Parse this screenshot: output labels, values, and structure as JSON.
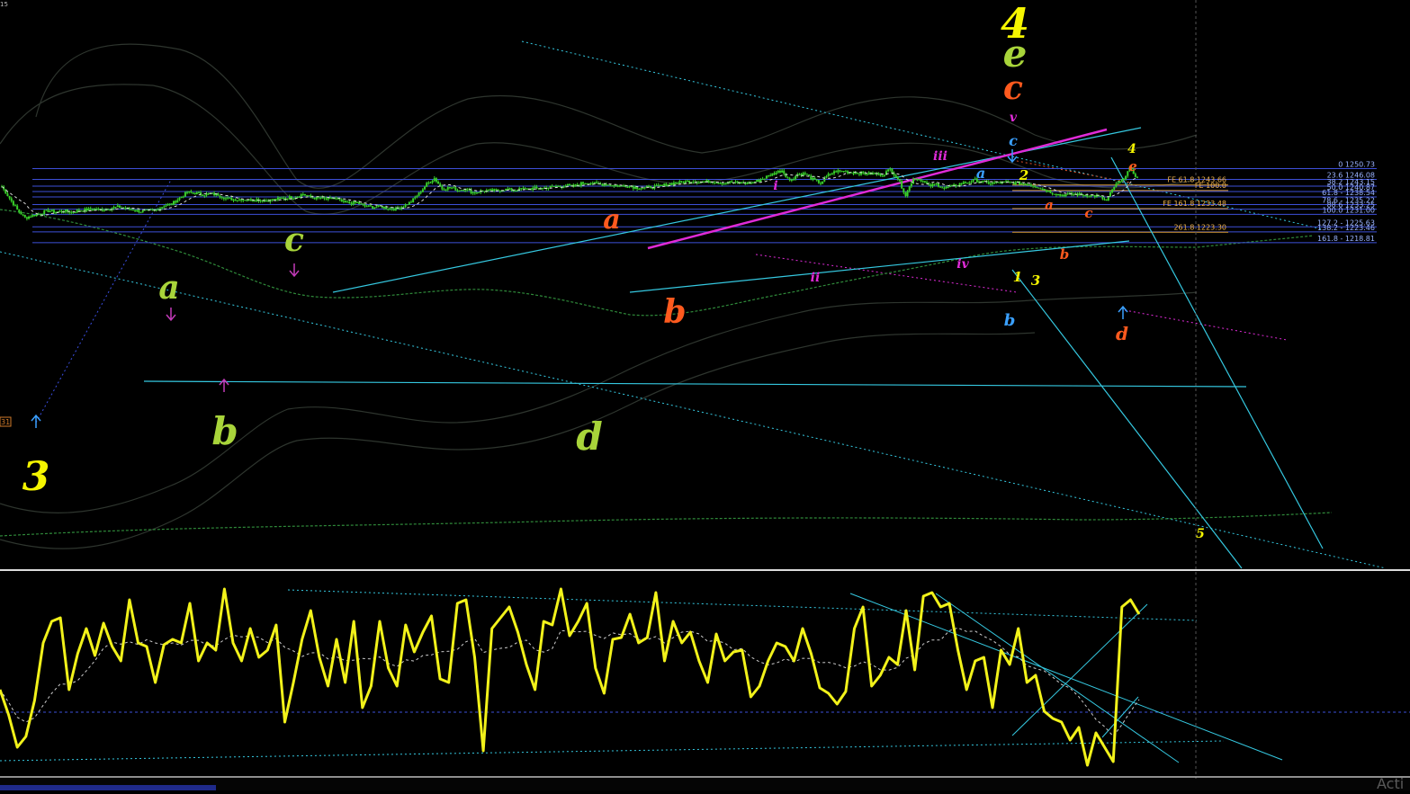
{
  "corner_tag": "15",
  "left_price_tag": "31",
  "watermark": "Acti",
  "colors": {
    "background": "#000000",
    "candle": "#39d12a",
    "fib_line": "#3d4fd8",
    "fib_text": "#9ab3ff",
    "fe_line": "#d89a36",
    "fe_text": "#f0b24a",
    "channel": "#35c8e0",
    "magenta": "#e02bd8",
    "oscillator": "#f2f21a"
  },
  "chart_data": [
    {
      "type": "line",
      "panel": "price",
      "y_scale": "price",
      "fib_retracement": [
        {
          "label": "0 1250.73",
          "level": 1250.73
        },
        {
          "label": "23.6 1246.08",
          "level": 1246.08
        },
        {
          "label": "38.2 1243.15",
          "level": 1243.15
        },
        {
          "label": "50.0 1240.87",
          "level": 1240.87
        },
        {
          "label": "61.8 - 1238.54",
          "level": 1238.54
        },
        {
          "label": "78.6 - 1235.22",
          "level": 1235.22
        },
        {
          "label": "88.6 1233.25",
          "level": 1233.25
        },
        {
          "label": "100.0 1231.00",
          "level": 1231.0
        },
        {
          "label": "127.2 - 1225.63",
          "level": 1225.63
        },
        {
          "label": "138.2 - 1223.46",
          "level": 1223.46
        },
        {
          "label": "161.8 - 1218.81",
          "level": 1218.81
        }
      ],
      "fib_expansion": [
        {
          "label": "FE 61.8 1243.66",
          "level": 1243.66
        },
        {
          "label": "FE 100.0",
          "level": 1241.3
        },
        {
          "label": "FE 161.8 1233.48",
          "level": 1233.48
        },
        {
          "label": "261.8 1223.30",
          "level": 1223.3
        }
      ],
      "series": [
        {
          "values": [
            1243.0,
            1238.0,
            1233.0,
            1229.5,
            1230.5,
            1231.5,
            1232.5,
            1232.0,
            1232.5,
            1232.0,
            1232.7,
            1233.0,
            1233.2,
            1233.0,
            1233.6,
            1234.2,
            1233.6,
            1233.0,
            1232.2,
            1232.6,
            1233.0,
            1234.8,
            1235.5,
            1238.0,
            1240.5,
            1240.2,
            1239.6,
            1239.8,
            1239.5,
            1237.9,
            1237.4,
            1237.6,
            1237.2,
            1237.4,
            1237.0,
            1237.2,
            1237.8,
            1238.2,
            1238.5,
            1239.8,
            1238.2,
            1238.0,
            1237.5,
            1238.0,
            1236.4,
            1235.8,
            1236.0,
            1234.5,
            1234.2,
            1234.3,
            1233.8,
            1233.2,
            1234.6,
            1236.5,
            1240.0,
            1244.0,
            1246.6,
            1242.0,
            1242.6,
            1241.5,
            1241.9,
            1240.4,
            1241.0,
            1241.2,
            1241.3,
            1241.8,
            1241.5,
            1241.7,
            1242.0,
            1242.2,
            1242.3,
            1242.8,
            1243.0,
            1243.5,
            1243.0,
            1244.3,
            1244.9,
            1244.0,
            1244.0,
            1243.6,
            1243.2,
            1243.4,
            1242.6,
            1242.4,
            1242.8,
            1243.0,
            1243.8,
            1244.5,
            1244.8,
            1245.4,
            1245.1,
            1245.0,
            1245.4,
            1244.6,
            1244.9,
            1244.6,
            1244.4,
            1244.6,
            1245.6,
            1247.2,
            1248.8,
            1250.0,
            1245.4,
            1248.3,
            1248.5,
            1246.0,
            1244.5,
            1248.0,
            1249.6,
            1249.6,
            1249.0,
            1248.8,
            1248.5,
            1248.5,
            1248.0,
            1250.5,
            1246.5,
            1239.3,
            1246.6,
            1246.0,
            1243.2,
            1244.0,
            1242.3,
            1243.0,
            1244.2,
            1244.8,
            1245.8,
            1245.0,
            1244.4,
            1244.6,
            1244.8,
            1244.6,
            1244.3,
            1244.0,
            1243.0,
            1241.6,
            1240.4,
            1239.3,
            1239.6,
            1239.7,
            1239.4,
            1239.2,
            1238.7,
            1236.8,
            1243.0,
            1245.6,
            1250.7,
            1246.8
          ],
          "price_range": [
            1212.0,
            1264.0
          ]
        }
      ],
      "wave_labels": [
        "3",
        "a",
        "b",
        "c",
        "d",
        "a",
        "b",
        "i",
        "ii",
        "iii",
        "iv",
        "v",
        "a",
        "b",
        "c",
        "4",
        "e",
        "c",
        "1",
        "2",
        "3",
        "a",
        "b",
        "c",
        "d",
        "4",
        "e",
        "5"
      ]
    },
    {
      "type": "line",
      "panel": "oscillator",
      "ylim": [
        0,
        100
      ],
      "series": [
        {
          "values": [
            44,
            30,
            12,
            18,
            38,
            70,
            82,
            84,
            44,
            64,
            78,
            63,
            81,
            68,
            60,
            94,
            70,
            68,
            48,
            69,
            72,
            70,
            92,
            60,
            70,
            66,
            100,
            70,
            60,
            78,
            62,
            66,
            80,
            26,
            48,
            72,
            88,
            62,
            46,
            72,
            48,
            82,
            34,
            46,
            82,
            56,
            46,
            80,
            65,
            76,
            85,
            50,
            48,
            92,
            94,
            62,
            10,
            78,
            84,
            90,
            76,
            58,
            44,
            82,
            80,
            100,
            74,
            82,
            92,
            56,
            42,
            72,
            73,
            86,
            70,
            73,
            98,
            60,
            82,
            70,
            76,
            60,
            48,
            75,
            60,
            65,
            66,
            40,
            46,
            60,
            70,
            68,
            60,
            78,
            64,
            45,
            42,
            36,
            43,
            78,
            90,
            46,
            52,
            62,
            58,
            88,
            55,
            96,
            98,
            90,
            92,
            66,
            44,
            60,
            62,
            34,
            66,
            58,
            78,
            48,
            52,
            32,
            28,
            26,
            16,
            23,
            2,
            20,
            12,
            4,
            90,
            94,
            86
          ]
        }
      ]
    }
  ]
}
